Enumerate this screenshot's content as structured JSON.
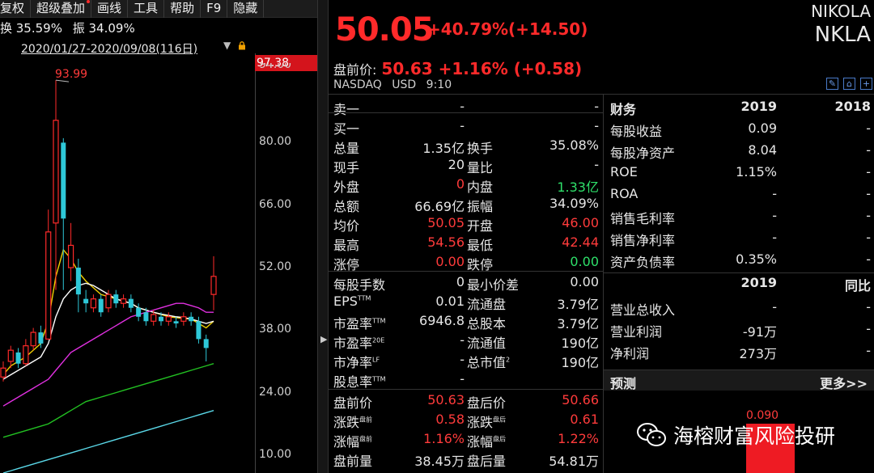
{
  "toolbar": {
    "items": [
      "复权",
      "超级叠加",
      "画线",
      "工具",
      "帮助",
      "F9",
      "隐藏"
    ]
  },
  "stats": {
    "turnover": "换 35.59%",
    "amplitude": "振 34.09%"
  },
  "range": {
    "text": "2020/01/27-2020/09/08(116日)"
  },
  "price_tag": "97.38",
  "y_axis_top_cut": "94.00",
  "high_label": "93.99",
  "chart_data": {
    "type": "candlestick",
    "y_ticks": [
      "80.00",
      "66.00",
      "52.00",
      "38.00",
      "24.00",
      "10.00"
    ],
    "ylim": [
      6,
      100
    ],
    "high_marker": 93.99,
    "candles": [
      {
        "o": 27.5,
        "c": 29.5,
        "h": 31,
        "l": 26.5,
        "up": true
      },
      {
        "o": 31,
        "c": 33.5,
        "h": 34.5,
        "l": 29.5,
        "up": true
      },
      {
        "o": 33,
        "c": 30.5,
        "h": 34,
        "l": 29.5,
        "up": false
      },
      {
        "o": 30.5,
        "c": 34.5,
        "h": 36,
        "l": 30,
        "up": true
      },
      {
        "o": 34.5,
        "c": 37.5,
        "h": 38.5,
        "l": 33.5,
        "up": true
      },
      {
        "o": 37.5,
        "c": 35,
        "h": 39,
        "l": 34,
        "up": false
      },
      {
        "o": 36,
        "c": 60,
        "h": 65,
        "l": 36,
        "up": true
      },
      {
        "o": 62,
        "c": 85,
        "h": 93.99,
        "l": 47,
        "up": true
      },
      {
        "o": 80,
        "c": 63,
        "h": 81,
        "l": 47,
        "up": false
      },
      {
        "o": 52,
        "c": 57,
        "h": 62,
        "l": 49,
        "up": true
      },
      {
        "o": 52,
        "c": 46,
        "h": 54,
        "l": 42,
        "up": false
      },
      {
        "o": 45,
        "c": 44,
        "h": 47,
        "l": 42,
        "up": false
      },
      {
        "o": 43,
        "c": 45,
        "h": 46,
        "l": 42,
        "up": true
      },
      {
        "o": 45,
        "c": 42,
        "h": 46,
        "l": 41,
        "up": false
      },
      {
        "o": 43,
        "c": 46,
        "h": 47,
        "l": 42,
        "up": true
      },
      {
        "o": 46,
        "c": 44,
        "h": 47,
        "l": 43,
        "up": false
      },
      {
        "o": 44,
        "c": 45,
        "h": 46,
        "l": 43,
        "up": true
      },
      {
        "o": 45,
        "c": 43,
        "h": 46,
        "l": 42,
        "up": false
      },
      {
        "o": 43,
        "c": 41,
        "h": 44,
        "l": 40,
        "up": false
      },
      {
        "o": 42,
        "c": 40,
        "h": 43,
        "l": 39,
        "up": false
      },
      {
        "o": 40,
        "c": 41.5,
        "h": 42.5,
        "l": 39,
        "up": true
      },
      {
        "o": 41,
        "c": 40,
        "h": 42,
        "l": 39,
        "up": false
      },
      {
        "o": 40,
        "c": 41,
        "h": 42,
        "l": 39,
        "up": true
      },
      {
        "o": 40,
        "c": 39.5,
        "h": 41,
        "l": 38.5,
        "up": false
      },
      {
        "o": 40,
        "c": 41,
        "h": 42,
        "l": 39,
        "up": true
      },
      {
        "o": 41,
        "c": 40,
        "h": 42,
        "l": 39,
        "up": false
      },
      {
        "o": 40,
        "c": 36,
        "h": 41,
        "l": 35,
        "up": false
      },
      {
        "o": 36,
        "c": 34,
        "h": 37,
        "l": 31,
        "up": false
      },
      {
        "o": 46,
        "c": 50.05,
        "h": 54.56,
        "l": 42.44,
        "up": true
      }
    ],
    "ma_lines": [
      {
        "color": "#f0d000",
        "values": [
          28,
          30,
          31,
          32,
          33.5,
          35,
          40,
          50,
          56,
          54,
          51,
          49,
          47.5,
          46,
          45.5,
          45,
          44.5,
          44,
          43,
          42.5,
          42,
          41.5,
          41,
          40.8,
          40.6,
          40.5,
          39.5,
          38.5,
          40
        ]
      },
      {
        "color": "#ffffff",
        "values": [
          27,
          28,
          29,
          30,
          31,
          32,
          35,
          41,
          45,
          47,
          48,
          48.5,
          48,
          47,
          46,
          45,
          44.5,
          44,
          43,
          42.5,
          42,
          41.6,
          41.3,
          41,
          40.8,
          40.5,
          40,
          39.5,
          40
        ]
      },
      {
        "color": "#e030e0",
        "values": [
          21,
          22,
          23,
          24,
          25,
          26,
          27,
          29,
          31,
          33,
          34,
          35,
          36,
          37,
          38,
          39,
          40,
          41,
          41.5,
          42,
          42.5,
          43,
          43.5,
          44,
          44,
          43.5,
          43,
          42,
          42
        ]
      },
      {
        "color": "#22c022",
        "values": [
          14,
          14.5,
          15,
          15.5,
          16,
          16.5,
          17,
          18,
          19,
          20,
          21,
          22,
          22.5,
          23,
          23.5,
          24,
          24.5,
          25,
          25.5,
          26,
          26.5,
          27,
          27.5,
          28,
          28.5,
          29,
          29.5,
          30,
          30.5
        ]
      },
      {
        "color": "#5ad8e8",
        "values": [
          6,
          6.5,
          7,
          7.5,
          8,
          8.5,
          9,
          9.5,
          10,
          10.5,
          11,
          11.5,
          12,
          12.5,
          13,
          13.5,
          14,
          14.5,
          15,
          15.5,
          16,
          16.5,
          17,
          17.5,
          18,
          18.5,
          19,
          19.5,
          20
        ]
      }
    ]
  },
  "quote": {
    "price": "50.05",
    "change": "+40.79%(+14.50)",
    "name_en": "NIKOLA",
    "ticker": "NKLA",
    "pre_label": "盘前价:",
    "pre_value": "50.63 +1.16% (+0.58)",
    "market": "NASDAQ",
    "currency": "USD",
    "time": "9:10"
  },
  "quote_table": [
    {
      "l1": "卖一",
      "v1": "-",
      "l2": "",
      "v2": "-",
      "c1": "",
      "c2": ""
    },
    {
      "l1": "买一",
      "v1": "-",
      "l2": "",
      "v2": "-",
      "c1": "",
      "c2": ""
    },
    {
      "l1": "总量",
      "v1": "1.35亿",
      "l2": "换手",
      "v2": "35.08%",
      "c1": "",
      "c2": ""
    },
    {
      "l1": "现手",
      "v1": "20",
      "l2": "量比",
      "v2": "-",
      "c1": "",
      "c2": ""
    },
    {
      "l1": "外盘",
      "v1": "0",
      "l2": "内盘",
      "v2": "1.33亿",
      "c1": "red",
      "c2": "green"
    },
    {
      "l1": "总额",
      "v1": "66.69亿",
      "l2": "振幅",
      "v2": "34.09%",
      "c1": "",
      "c2": ""
    },
    {
      "l1": "均价",
      "v1": "50.05",
      "l2": "开盘",
      "v2": "46.00",
      "c1": "red",
      "c2": "red"
    },
    {
      "l1": "最高",
      "v1": "54.56",
      "l2": "最低",
      "v2": "42.44",
      "c1": "red",
      "c2": "red"
    },
    {
      "l1": "涨停",
      "v1": "0.00",
      "l2": "跌停",
      "v2": "0.00",
      "c1": "red",
      "c2": "green"
    },
    {
      "l1": "每股手数",
      "v1": "0",
      "l2": "最小价差",
      "v2": "0.00",
      "c1": "",
      "c2": ""
    },
    {
      "l1": "EPS",
      "s1": "TTM",
      "v1": "0.01",
      "l2": "流通盘",
      "v2": "3.79亿",
      "c1": "",
      "c2": ""
    },
    {
      "l1": "市盈率",
      "s1": "TTM",
      "v1": "6946.8",
      "l2": "总股本",
      "v2": "3.79亿",
      "c1": "",
      "c2": ""
    },
    {
      "l1": "市盈率",
      "s1": "20E",
      "v1": "-",
      "l2": "流通值",
      "v2": "190亿",
      "c1": "",
      "c2": ""
    },
    {
      "l1": "市净率",
      "s1": "LF",
      "v1": "-",
      "l2": "总市值",
      "s2": "2",
      "v2": "190亿",
      "c1": "",
      "c2": ""
    },
    {
      "l1": "股息率",
      "s1": "TTM",
      "v1": "-",
      "l2": "",
      "v2": "",
      "c1": "",
      "c2": ""
    },
    {
      "l1": "盘前价",
      "v1": "50.63",
      "l2": "盘后价",
      "v2": "50.66",
      "c1": "red",
      "c2": "red"
    },
    {
      "l1": "涨跌",
      "s1": "盘前",
      "v1": "0.58",
      "l2": "涨跌",
      "s2": "盘后",
      "v2": "0.61",
      "c1": "red",
      "c2": "red"
    },
    {
      "l1": "涨幅",
      "s1": "盘前",
      "v1": "1.16%",
      "l2": "涨幅",
      "s2": "盘后",
      "v2": "1.22%",
      "c1": "red",
      "c2": "red"
    },
    {
      "l1": "盘前量",
      "v1": "38.45万",
      "l2": "盘后量",
      "v2": "54.81万",
      "c1": "",
      "c2": ""
    }
  ],
  "finance_table": [
    {
      "l": "财务",
      "v1": "2019",
      "v2": "2018",
      "hdr": true
    },
    {
      "l": "每股收益",
      "v1": "0.09",
      "v2": "-"
    },
    {
      "l": "每股净资产",
      "v1": "8.04",
      "v2": "-"
    },
    {
      "l": "ROE",
      "v1": "1.15%",
      "v2": "-"
    },
    {
      "l": "ROA",
      "v1": "-",
      "v2": "-"
    },
    {
      "l": "销售毛利率",
      "v1": "-",
      "v2": "-"
    },
    {
      "l": "销售净利率",
      "v1": "-",
      "v2": "-"
    },
    {
      "l": "资产负债率",
      "v1": "0.35%",
      "v2": "-"
    },
    {
      "l": "",
      "v1": "2019",
      "v2": "同比",
      "hdr": true
    },
    {
      "l": "营业总收入",
      "v1": "-",
      "v2": "-"
    },
    {
      "l": "营业利润",
      "v1": "-91万",
      "v2": "-"
    },
    {
      "l": "净利润",
      "v1": "273万",
      "v2": "-"
    }
  ],
  "forecast": {
    "title": "预测",
    "more": "更多>>",
    "value": "0.090"
  },
  "watermark": "海榕财富风险投研",
  "colors": {
    "up": "#ff2a2a",
    "down_candle": "#2ec8d8",
    "green": "#2ee06a",
    "accent_tag": "#d4141c"
  }
}
